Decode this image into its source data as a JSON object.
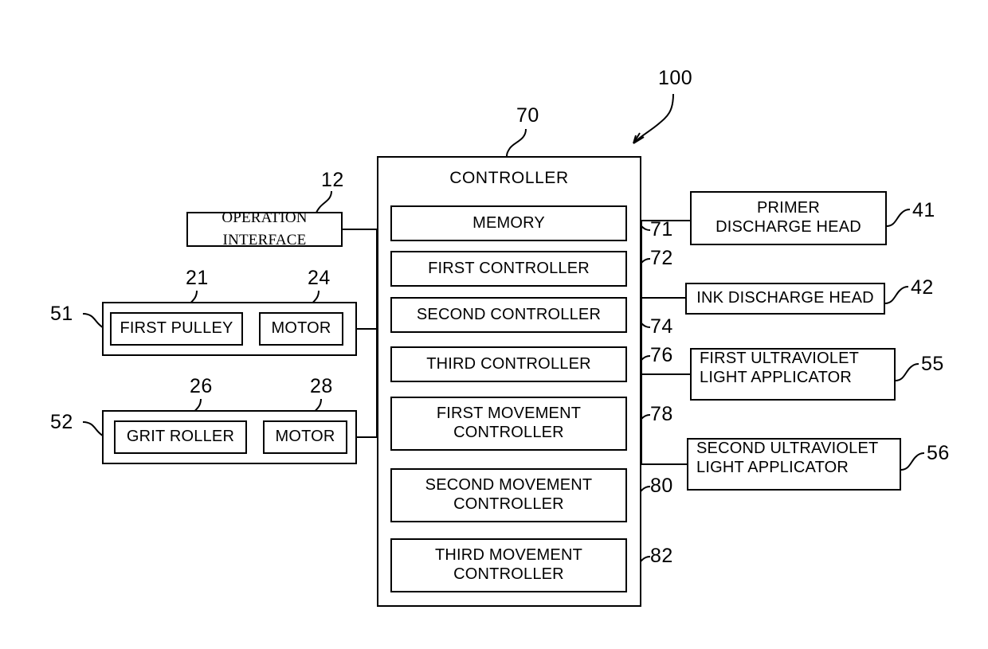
{
  "figure": {
    "system_ref": "100",
    "controller_ref": "70",
    "controller_title": "CONTROLLER"
  },
  "controller": {
    "title": "CONTROLLER",
    "ref": "70",
    "modules": [
      {
        "label": "MEMORY",
        "ref": "71"
      },
      {
        "label": "FIRST CONTROLLER",
        "ref": "72"
      },
      {
        "label": "SECOND CONTROLLER",
        "ref": "74"
      },
      {
        "label": "THIRD CONTROLLER",
        "ref": "76"
      },
      {
        "label": "FIRST MOVEMENT CONTROLLER",
        "line1": "FIRST MOVEMENT",
        "line2": "CONTROLLER",
        "ref": "78"
      },
      {
        "label": "SECOND MOVEMENT CONTROLLER",
        "line1": "SECOND MOVEMENT",
        "line2": "CONTROLLER",
        "ref": "80"
      },
      {
        "label": "THIRD MOVEMENT CONTROLLER",
        "line1": "THIRD MOVEMENT",
        "line2": "CONTROLLER",
        "ref": "82"
      }
    ]
  },
  "left_side": {
    "operation_interface": {
      "line1": "OPERATION",
      "line2": "INTERFACE",
      "ref": "12"
    },
    "groups": [
      {
        "ref": "51",
        "items": [
          {
            "label": "FIRST PULLEY",
            "ref": "21"
          },
          {
            "label": "MOTOR",
            "ref": "24"
          }
        ]
      },
      {
        "ref": "52",
        "items": [
          {
            "label": "GRIT ROLLER",
            "ref": "26"
          },
          {
            "label": "MOTOR",
            "ref": "28"
          }
        ]
      }
    ]
  },
  "right_side": {
    "devices": [
      {
        "line1": "PRIMER",
        "line2": "DISCHARGE HEAD",
        "label": "PRIMER DISCHARGE HEAD",
        "ref": "41",
        "align": "center"
      },
      {
        "line1": "INK DISCHARGE HEAD",
        "line2": "",
        "label": "INK DISCHARGE HEAD",
        "ref": "42",
        "align": "center"
      },
      {
        "line1": "FIRST ULTRAVIOLET",
        "line2": "LIGHT APPLICATOR",
        "label": "FIRST ULTRAVIOLET LIGHT APPLICATOR",
        "ref": "55",
        "align": "left"
      },
      {
        "line1": "SECOND ULTRAVIOLET",
        "line2": "LIGHT APPLICATOR",
        "label": "SECOND ULTRAVIOLET LIGHT APPLICATOR",
        "ref": "56",
        "align": "left"
      }
    ]
  },
  "colors": {
    "stroke": "#000000",
    "background": "#ffffff"
  }
}
